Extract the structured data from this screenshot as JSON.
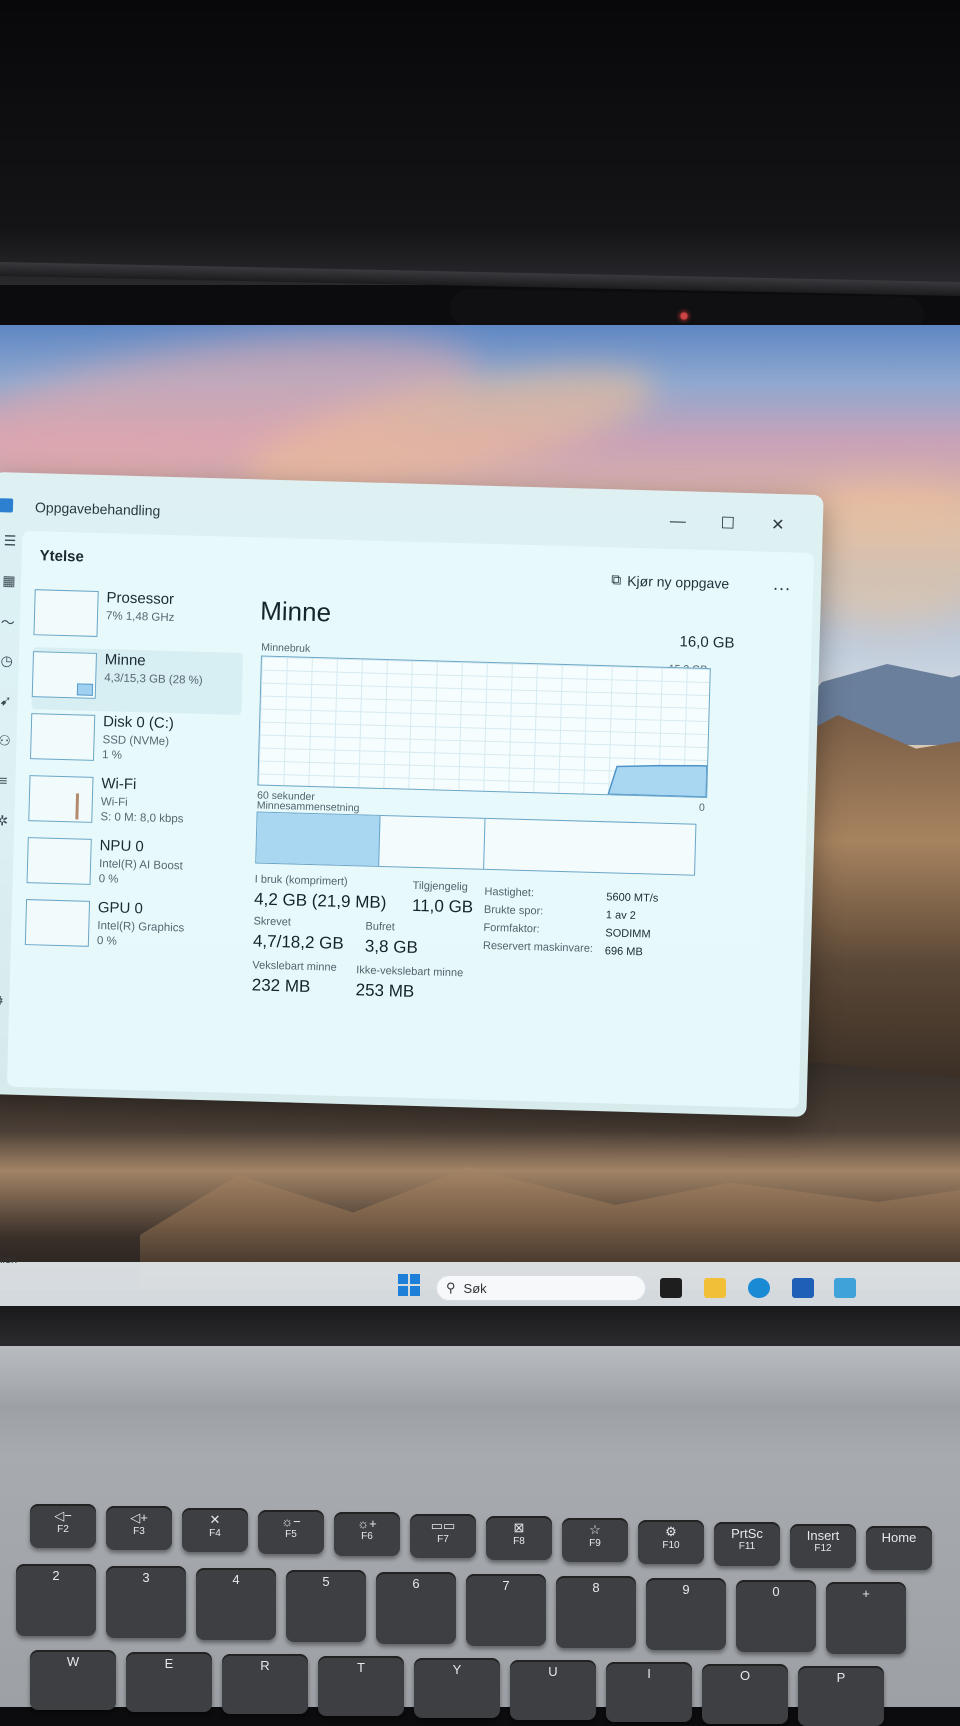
{
  "window": {
    "title": "Oppgavebehandling",
    "section": "Ytelse",
    "run_task_label": "Kjør ny oppgave",
    "more_label": "...",
    "controls": {
      "minimize": "—",
      "maximize": "☐",
      "close": "✕"
    }
  },
  "resources": [
    {
      "name": "Prosessor",
      "sub": "7% 1,48 GHz"
    },
    {
      "name": "Minne",
      "sub": "4,3/15,3 GB (28 %)"
    },
    {
      "name": "Disk 0 (C:)",
      "sub1": "SSD (NVMe)",
      "sub2": "1 %"
    },
    {
      "name": "Wi-Fi",
      "sub1": "Wi-Fi",
      "sub2": "S: 0 M: 8,0 kbps"
    },
    {
      "name": "NPU 0",
      "sub1": "Intel(R) AI Boost",
      "sub2": "0 %"
    },
    {
      "name": "GPU 0",
      "sub1": "Intel(R) Graphics",
      "sub2": "0 %"
    }
  ],
  "memory": {
    "title": "Minne",
    "total": "16,0 GB",
    "usage_label": "Minnebruk",
    "graph_max": "15,3 GB",
    "graph_span": "60 sekunder",
    "graph_min": "0",
    "composition_label": "Minnesammensetning",
    "in_use_fraction": 0.28,
    "stats": {
      "in_use_label": "I bruk (komprimert)",
      "in_use_value": "4,2 GB (21,9 MB)",
      "available_label": "Tilgjengelig",
      "available_value": "11,0 GB",
      "committed_label": "Skrevet",
      "committed_value": "4,7/18,2 GB",
      "cached_label": "Bufret",
      "cached_value": "3,8 GB",
      "paged_label": "Vekslebart minne",
      "paged_value": "232 MB",
      "nonpaged_label": "Ikke-vekslebart minne",
      "nonpaged_value": "253 MB"
    },
    "details": [
      {
        "label": "Hastighet:",
        "value": "5600 MT/s"
      },
      {
        "label": "Brukte spor:",
        "value": "1 av 2"
      },
      {
        "label": "Formfaktor:",
        "value": "SODIMM"
      },
      {
        "label": "Reservert maskinvare:",
        "value": "696 MB"
      }
    ]
  },
  "taskbar": {
    "search_placeholder": "Søk",
    "left_text": "lien"
  },
  "keyboard": {
    "fn_row": [
      {
        "top": "◁−",
        "sub": "F2"
      },
      {
        "top": "◁+",
        "sub": "F3"
      },
      {
        "top": "✕",
        "sub": "F4"
      },
      {
        "top": "☼−",
        "sub": "F5"
      },
      {
        "top": "☼+",
        "sub": "F6"
      },
      {
        "top": "▭▭",
        "sub": "F7"
      },
      {
        "top": "⊠",
        "sub": "F8"
      },
      {
        "top": "☆",
        "sub": "F9"
      },
      {
        "top": "⚙",
        "sub": "F10"
      },
      {
        "top": "PrtSc",
        "sub": "F11"
      },
      {
        "top": "Insert",
        "sub": "F12"
      },
      {
        "top": "Home",
        "sub": ""
      }
    ],
    "num_row": [
      "2",
      "3",
      "4",
      "5",
      "6",
      "7",
      "8",
      "9",
      "0",
      "+"
    ],
    "letter_row": [
      "W",
      "E",
      "R",
      "T",
      "Y",
      "U",
      "I",
      "O",
      "P"
    ]
  }
}
